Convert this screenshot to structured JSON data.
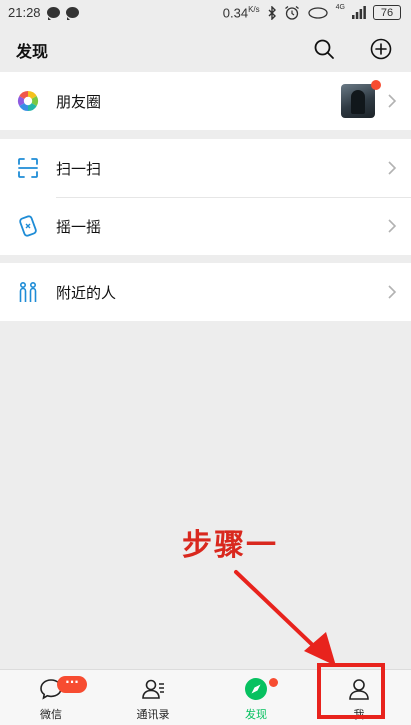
{
  "status_bar": {
    "time": "21:28",
    "speed": "0.34",
    "speed_unit": "K/s",
    "signal": "4G",
    "battery": "76"
  },
  "header": {
    "title": "发现",
    "search_icon": "search-icon",
    "add_icon": "add-circle-icon"
  },
  "sections": {
    "moments": {
      "label": "朋友圈",
      "icon": "moments-camera-icon"
    },
    "scan": {
      "label": "扫一扫",
      "icon": "scan-icon"
    },
    "shake": {
      "label": "摇一摇",
      "icon": "shake-icon"
    },
    "nearby": {
      "label": "附近的人",
      "icon": "nearby-people-icon"
    }
  },
  "annotation": {
    "text": "步骤一"
  },
  "tabbar": {
    "chats": {
      "label": "微信",
      "badge": "···"
    },
    "contacts": {
      "label": "通讯录"
    },
    "discover": {
      "label": "发现"
    },
    "me": {
      "label": "我"
    }
  },
  "colors": {
    "accent": "#07c160",
    "badge": "#f74c31",
    "annotation_red": "#d9281e"
  }
}
